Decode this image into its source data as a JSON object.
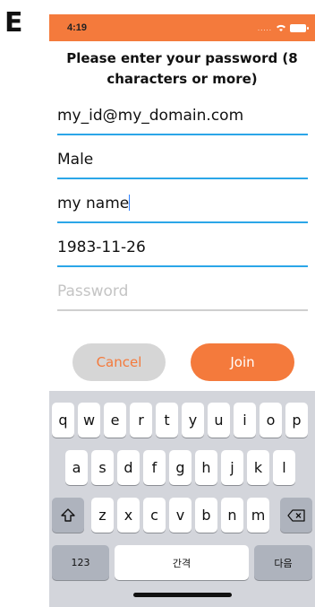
{
  "figure_label": "E",
  "status": {
    "time": "4:19",
    "signal": "....."
  },
  "prompt": "Please enter your password (8 characters or more)",
  "form": {
    "email": "my_id@my_domain.com",
    "gender": "Male",
    "name": "my name",
    "birthdate": "1983-11-26",
    "password_placeholder": "Password"
  },
  "buttons": {
    "cancel": "Cancel",
    "join": "Join"
  },
  "keyboard": {
    "row1": [
      "q",
      "w",
      "e",
      "r",
      "t",
      "y",
      "u",
      "i",
      "o",
      "p"
    ],
    "row2": [
      "a",
      "s",
      "d",
      "f",
      "g",
      "h",
      "j",
      "k",
      "l"
    ],
    "row3": [
      "z",
      "x",
      "c",
      "v",
      "b",
      "n",
      "m"
    ],
    "numbers": "123",
    "space": "간격",
    "next": "다음"
  },
  "colors": {
    "accent": "#f47a3c",
    "underline_active": "#2ba6e8",
    "underline_inactive": "#cfcfcf",
    "keyboard_bg": "#d3d5db"
  },
  "icons": {
    "shift": "shift-icon",
    "backspace": "backspace-icon",
    "wifi": "wifi-icon",
    "battery": "battery-icon"
  }
}
